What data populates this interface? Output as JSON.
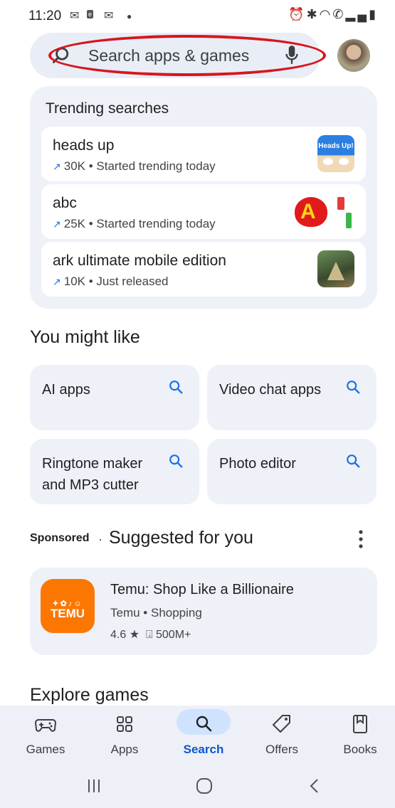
{
  "status_bar": {
    "time": "11:20",
    "left_icons": [
      "gmail-icon",
      "ebay-icon",
      "gmail-icon",
      "dot-icon"
    ],
    "right_icons": [
      "alarm-icon",
      "bluetooth-icon",
      "wifi-icon",
      "call-icon",
      "signal-icon",
      "battery-icon"
    ]
  },
  "search": {
    "placeholder": "Search apps & games"
  },
  "trending": {
    "title": "Trending searches",
    "items": [
      {
        "query": "heads up",
        "meta": "30K • Started trending today",
        "thumb": "heads-up-icon",
        "thumb_label": "Heads Up!"
      },
      {
        "query": "abc",
        "meta": "25K • Started trending today",
        "thumb": "abc-app-icon"
      },
      {
        "query": "ark ultimate mobile edition",
        "meta": "10K • Just released",
        "thumb": "ark-game-icon"
      }
    ]
  },
  "you_might_like": {
    "title": "You might like",
    "cards": [
      {
        "label": "AI apps"
      },
      {
        "label": "Video chat apps"
      },
      {
        "label": "Ringtone maker and MP3 cutter"
      },
      {
        "label": "Photo editor"
      }
    ]
  },
  "suggested": {
    "sponsored": "Sponsored",
    "separator": "·",
    "title": "Suggested for you",
    "app": {
      "name": "Temu: Shop Like a Billionaire",
      "developer": "Temu",
      "category": "Shopping",
      "rating": "4.6",
      "downloads": "500M+",
      "icon_text": "TEMU",
      "icon_color": "#fb7702"
    }
  },
  "explore": {
    "title": "Explore games"
  },
  "bottom_nav": {
    "items": [
      {
        "label": "Games",
        "icon": "gamepad-icon"
      },
      {
        "label": "Apps",
        "icon": "apps-grid-icon"
      },
      {
        "label": "Search",
        "icon": "search-icon",
        "active": true
      },
      {
        "label": "Offers",
        "icon": "tag-icon"
      },
      {
        "label": "Books",
        "icon": "bookmark-icon"
      }
    ]
  },
  "colors": {
    "accent": "#1a73e8",
    "active_pill": "#cfe3ff",
    "card_bg": "#eef1f8",
    "annotation_red": "#d6161e"
  }
}
